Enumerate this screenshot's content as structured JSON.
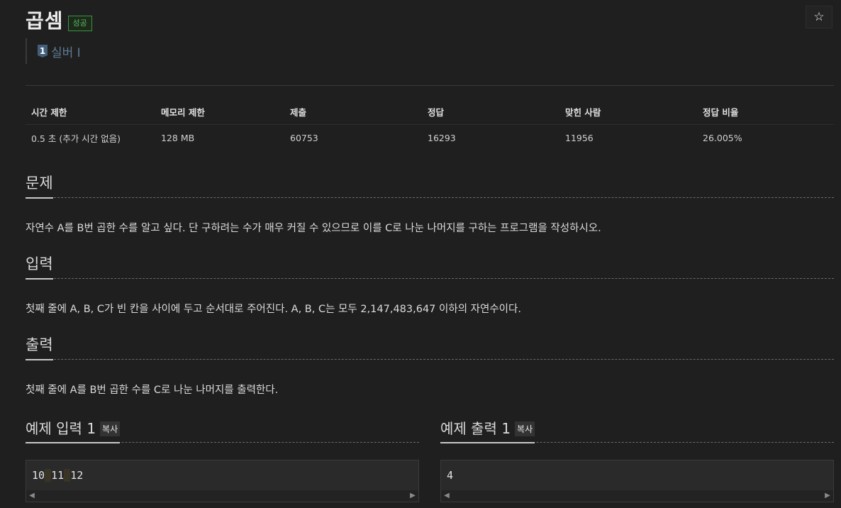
{
  "problem": {
    "title": "곱셈",
    "status_badge": "성공",
    "tier": "실버 I",
    "tier_number": "1",
    "favorite_icon": "star-icon"
  },
  "info_table": {
    "headers": [
      "시간 제한",
      "메모리 제한",
      "제출",
      "정답",
      "맞힌 사람",
      "정답 비율"
    ],
    "values": [
      "0.5 초 (추가 시간 없음)",
      "128 MB",
      "60753",
      "16293",
      "11956",
      "26.005%"
    ]
  },
  "sections": {
    "description": {
      "heading": "문제",
      "text": "자연수 A를 B번 곱한 수를 알고 싶다. 단 구하려는 수가 매우 커질 수 있으므로 이를 C로 나눈 나머지를 구하는 프로그램을 작성하시오."
    },
    "input": {
      "heading": "입력",
      "text": "첫째 줄에 A, B, C가 빈 칸을 사이에 두고 순서대로 주어진다. A, B, C는 모두 2,147,483,647 이하의 자연수이다."
    },
    "output": {
      "heading": "출력",
      "text": "첫째 줄에 A를 B번 곱한 수를 C로 나눈 나머지를 출력한다."
    }
  },
  "samples": {
    "input": {
      "heading": "예제 입력 1",
      "copy_label": "복사",
      "tokens": [
        "10",
        "11",
        "12"
      ]
    },
    "output": {
      "heading": "예제 출력 1",
      "copy_label": "복사",
      "value": "4"
    }
  },
  "colors": {
    "background": "#1f1f1f",
    "success_green": "#5cb85c",
    "tier_blue": "#5f7c95"
  }
}
